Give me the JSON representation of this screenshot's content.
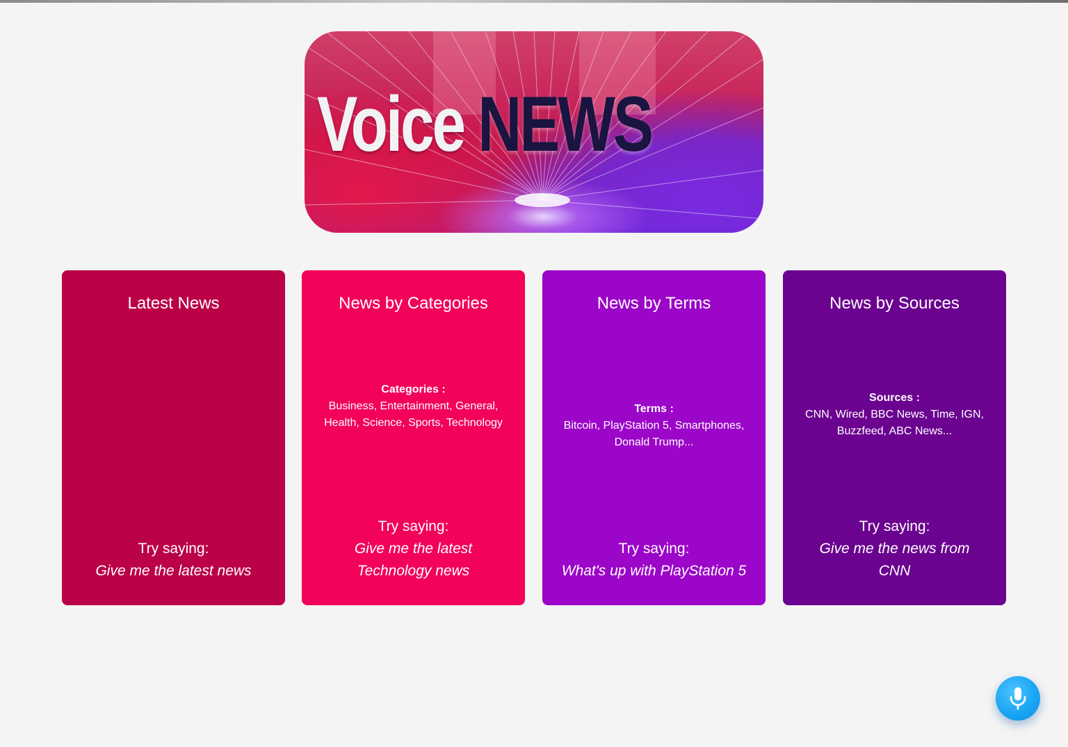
{
  "banner": {
    "word1": "Voice",
    "word2": "NEWS"
  },
  "cards": [
    {
      "title": "Latest News",
      "info_heading": "",
      "info_text": "",
      "try_label": "Try saying:",
      "example": "Give me the latest news",
      "color": "#bb0147"
    },
    {
      "title": "News by Categories",
      "info_heading": "Categories :",
      "info_text": "Business, Entertainment, General, Health, Science, Sports, Technology",
      "try_label": "Try saying:",
      "example": "Give me the latest Technology news",
      "color": "#f2025a"
    },
    {
      "title": "News by Terms",
      "info_heading": "Terms :",
      "info_text": "Bitcoin, PlayStation 5, Smartphones, Donald Trump...",
      "try_label": "Try saying:",
      "example": "What's up with PlayStation 5",
      "color": "#9c06c8"
    },
    {
      "title": "News by Sources",
      "info_heading": "Sources :",
      "info_text": "CNN, Wired, BBC News, Time, IGN, Buzzfeed, ABC News...",
      "try_label": "Try saying:",
      "example": "Give me the news from CNN",
      "color": "#6b0390"
    }
  ],
  "mic": {
    "icon": "microphone-icon",
    "color": "#1aa6f3"
  },
  "page": {
    "background": "#f4f4f4"
  }
}
